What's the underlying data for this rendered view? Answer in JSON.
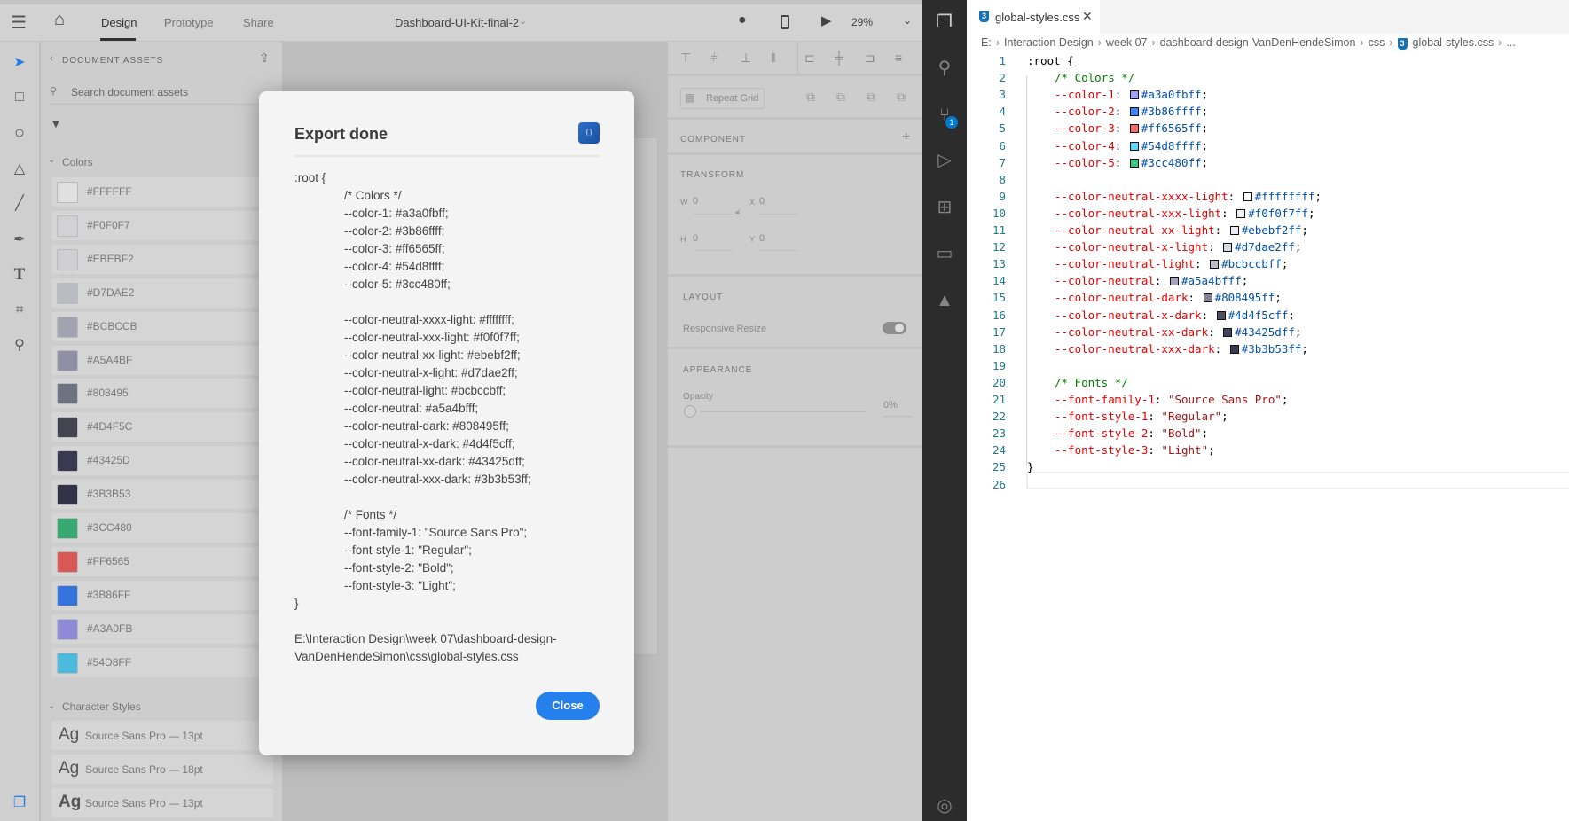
{
  "xd": {
    "tabs": [
      "Design",
      "Prototype",
      "Share"
    ],
    "doc_title": "Dashboard-UI-Kit-final-2",
    "zoom": "29%",
    "assets": {
      "title": "DOCUMENT ASSETS",
      "search_placeholder": "Search document assets",
      "colors_heading": "Colors",
      "colors": [
        {
          "label": "#FFFFFF",
          "hex": "#e0e0e0"
        },
        {
          "label": "#F0F0F7",
          "hex": "#d2d2d6"
        },
        {
          "label": "#EBEBF2",
          "hex": "#cfcfd3"
        },
        {
          "label": "#D7DAE2",
          "hex": "#bbbcc2"
        },
        {
          "label": "#BCBCCB",
          "hex": "#a3a2b0"
        },
        {
          "label": "#A5A4BF",
          "hex": "#908fa5"
        },
        {
          "label": "#808495",
          "hex": "#6f7281"
        },
        {
          "label": "#4D4F5C",
          "hex": "#434450"
        },
        {
          "label": "#43425D",
          "hex": "#3a3951"
        },
        {
          "label": "#3B3B53",
          "hex": "#333348"
        },
        {
          "label": "#3CC480",
          "hex": "#36a870"
        },
        {
          "label": "#FF6565",
          "hex": "#d85858"
        },
        {
          "label": "#3B86FF",
          "hex": "#3474dc"
        },
        {
          "label": "#A3A0FB",
          "hex": "#8d8bd8"
        },
        {
          "label": "#54D8FF",
          "hex": "#4bbadc"
        }
      ],
      "char_heading": "Character Styles",
      "char_styles": [
        {
          "ag": "Ag",
          "label": "Source Sans Pro — 13pt",
          "bold": false
        },
        {
          "ag": "Ag",
          "label": "Source Sans Pro — 18pt",
          "bold": false
        },
        {
          "ag": "Ag",
          "label": "Source Sans Pro — 13pt",
          "bold": true
        }
      ]
    },
    "props": {
      "repeat_grid": "Repeat Grid",
      "component": "COMPONENT",
      "transform": "TRANSFORM",
      "w_label": "W",
      "w": "0",
      "x_label": "X",
      "x": "0",
      "h_label": "H",
      "h": "0",
      "y_label": "Y",
      "y": "0",
      "layout": "LAYOUT",
      "responsive": "Responsive Resize",
      "appearance": "APPEARANCE",
      "opacity_label": "Opacity",
      "opacity": "0%"
    },
    "modal": {
      "title": "Export done",
      "lines": [
        {
          "t": ":root {",
          "i": 0
        },
        {
          "t": "/* Colors */",
          "i": 1
        },
        {
          "t": "--color-1: #a3a0fbff;",
          "i": 1
        },
        {
          "t": "--color-2: #3b86ffff;",
          "i": 1
        },
        {
          "t": "--color-3: #ff6565ff;",
          "i": 1
        },
        {
          "t": "--color-4: #54d8ffff;",
          "i": 1
        },
        {
          "t": "--color-5: #3cc480ff;",
          "i": 1
        },
        {
          "t": "",
          "i": 1
        },
        {
          "t": "--color-neutral-xxxx-light: #ffffffff;",
          "i": 1
        },
        {
          "t": "--color-neutral-xxx-light: #f0f0f7ff;",
          "i": 1
        },
        {
          "t": "--color-neutral-xx-light: #ebebf2ff;",
          "i": 1
        },
        {
          "t": "--color-neutral-x-light: #d7dae2ff;",
          "i": 1
        },
        {
          "t": "--color-neutral-light: #bcbccbff;",
          "i": 1
        },
        {
          "t": "--color-neutral: #a5a4bfff;",
          "i": 1
        },
        {
          "t": "--color-neutral-dark: #808495ff;",
          "i": 1
        },
        {
          "t": "--color-neutral-x-dark: #4d4f5cff;",
          "i": 1
        },
        {
          "t": "--color-neutral-xx-dark: #43425dff;",
          "i": 1
        },
        {
          "t": "--color-neutral-xxx-dark: #3b3b53ff;",
          "i": 1
        },
        {
          "t": "",
          "i": 1
        },
        {
          "t": "/* Fonts */",
          "i": 1
        },
        {
          "t": "--font-family-1: \"Source Sans Pro\";",
          "i": 1
        },
        {
          "t": "--font-style-1: \"Regular\";",
          "i": 1
        },
        {
          "t": "--font-style-2: \"Bold\";",
          "i": 1
        },
        {
          "t": "--font-style-3: \"Light\";",
          "i": 1
        },
        {
          "t": "}",
          "i": 0
        },
        {
          "t": "",
          "i": 0
        },
        {
          "t": "E:\\Interaction Design\\week 07\\dashboard-design-",
          "i": 0
        },
        {
          "t": "VanDenHendeSimon\\css\\global-styles.css",
          "i": 0
        }
      ],
      "close": "Close"
    }
  },
  "vscode": {
    "scm_badge": "1",
    "tab": "global-styles.css",
    "breadcrumbs": [
      "E:",
      "Interaction Design",
      "week 07",
      "dashboard-design-VanDenHendeSimon",
      "css",
      "global-styles.css",
      "..."
    ],
    "lines": [
      {
        "text": ":root {"
      },
      {
        "comment": "/* Colors */"
      },
      {
        "prop": "--color-1",
        "val": "#a3a0fbff",
        "swatch": "#a3a0fb"
      },
      {
        "prop": "--color-2",
        "val": "#3b86ffff",
        "swatch": "#3b86ff"
      },
      {
        "prop": "--color-3",
        "val": "#ff6565ff",
        "swatch": "#ff6565"
      },
      {
        "prop": "--color-4",
        "val": "#54d8ffff",
        "swatch": "#54d8ff"
      },
      {
        "prop": "--color-5",
        "val": "#3cc480ff",
        "swatch": "#3cc480"
      },
      {},
      {
        "prop": "--color-neutral-xxxx-light",
        "val": "#ffffffff",
        "swatch": "#ffffff"
      },
      {
        "prop": "--color-neutral-xxx-light",
        "val": "#f0f0f7ff",
        "swatch": "#f0f0f7"
      },
      {
        "prop": "--color-neutral-xx-light",
        "val": "#ebebf2ff",
        "swatch": "#ebebf2"
      },
      {
        "prop": "--color-neutral-x-light",
        "val": "#d7dae2ff",
        "swatch": "#d7dae2"
      },
      {
        "prop": "--color-neutral-light",
        "val": "#bcbccbff",
        "swatch": "#bcbccb"
      },
      {
        "prop": "--color-neutral",
        "val": "#a5a4bfff",
        "swatch": "#a5a4bf"
      },
      {
        "prop": "--color-neutral-dark",
        "val": "#808495ff",
        "swatch": "#808495"
      },
      {
        "prop": "--color-neutral-x-dark",
        "val": "#4d4f5cff",
        "swatch": "#4d4f5c"
      },
      {
        "prop": "--color-neutral-xx-dark",
        "val": "#43425dff",
        "swatch": "#43425d"
      },
      {
        "prop": "--color-neutral-xxx-dark",
        "val": "#3b3b53ff",
        "swatch": "#3b3b53"
      },
      {},
      {
        "comment": "/* Fonts */"
      },
      {
        "prop": "--font-family-1",
        "str": "\"Source Sans Pro\""
      },
      {
        "prop": "--font-style-1",
        "str": "\"Regular\""
      },
      {
        "prop": "--font-style-2",
        "str": "\"Bold\""
      },
      {
        "prop": "--font-style-3",
        "str": "\"Light\""
      },
      {
        "text": "}"
      },
      {}
    ]
  }
}
